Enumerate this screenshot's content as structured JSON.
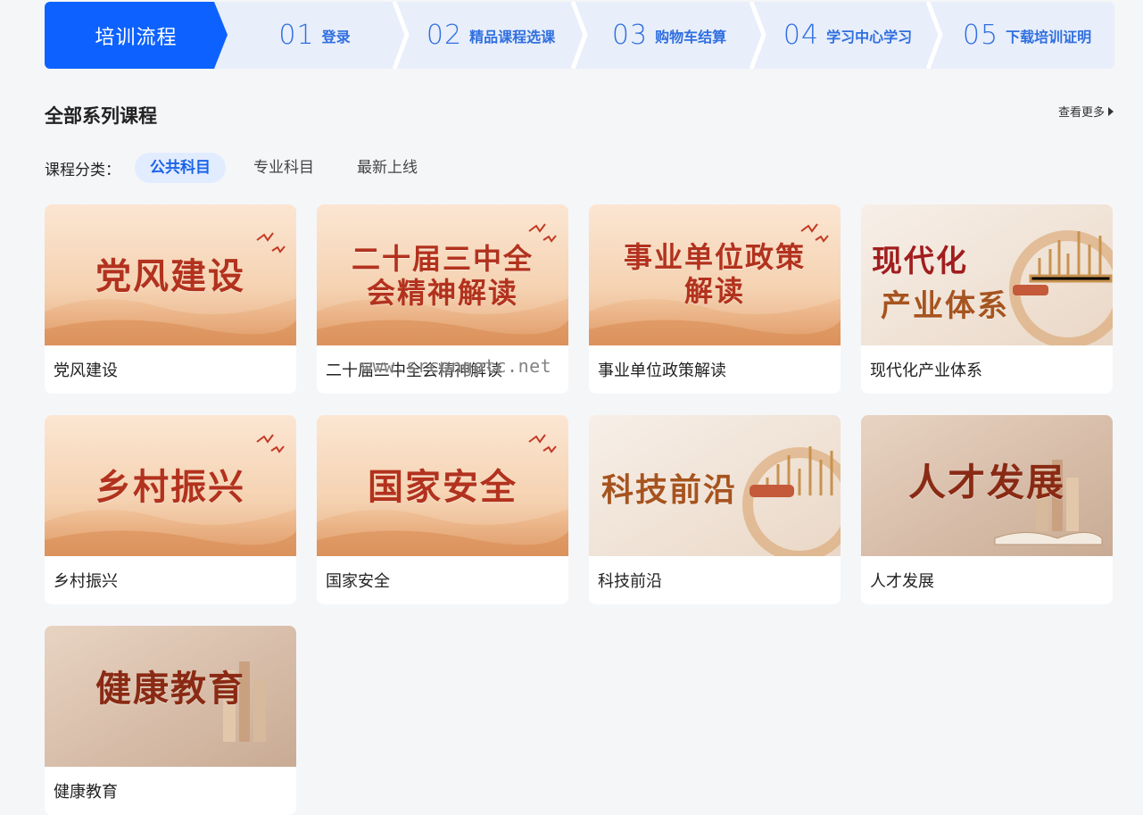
{
  "steps": {
    "head": "培训流程",
    "items": [
      {
        "num": "01",
        "label": "登录"
      },
      {
        "num": "02",
        "label": "精品课程选课"
      },
      {
        "num": "03",
        "label": "购物车结算"
      },
      {
        "num": "04",
        "label": "学习中心学习"
      },
      {
        "num": "05",
        "label": "下载培训证明"
      }
    ]
  },
  "section": {
    "title": "全部系列课程",
    "more": "查看更多"
  },
  "filter": {
    "label": "课程分类：",
    "options": [
      "公共科目",
      "专业科目",
      "最新上线"
    ],
    "active": "公共科目"
  },
  "courses": [
    {
      "thumb_text": "党风建设",
      "title": "党风建设"
    },
    {
      "thumb_text_1": "二十届三中全",
      "thumb_text_2": "会精神解读",
      "title": "二十届三中全会精神解读"
    },
    {
      "thumb_text_1": "事业单位政策",
      "thumb_text_2": "解读",
      "title": "事业单位政策解读"
    },
    {
      "thumb_text_1": "现代化",
      "thumb_text_2": "产业体系",
      "title": "现代化产业体系"
    },
    {
      "thumb_text": "乡村振兴",
      "title": "乡村振兴"
    },
    {
      "thumb_text": "国家安全",
      "title": "国家安全"
    },
    {
      "thumb_text": "科技前沿",
      "title": "科技前沿"
    },
    {
      "thumb_text": "人才发展",
      "title": "人才发展"
    },
    {
      "thumb_text": "健康教育",
      "title": "健康教育"
    }
  ],
  "watermark": "www.srcongotc.net",
  "colors": {
    "primary": "#0d62ff",
    "step_bg": "#e8eefa",
    "headline": "#b2321e"
  }
}
